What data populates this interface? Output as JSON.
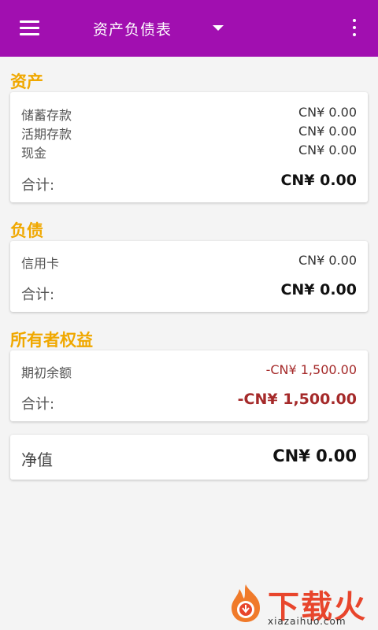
{
  "appbar": {
    "title": "资产负债表",
    "menu_icon": "hamburger-menu-icon",
    "dropdown_icon": "caret-down-icon",
    "more_icon": "more-vertical-icon",
    "color": "#a10fb0"
  },
  "sections": {
    "assets": {
      "title": "资产",
      "items": [
        {
          "label": "储蓄存款",
          "value": "CN¥ 0.00"
        },
        {
          "label": "活期存款",
          "value": "CN¥ 0.00"
        },
        {
          "label": "现金",
          "value": "CN¥ 0.00"
        }
      ],
      "total_label": "合计:",
      "total_value": "CN¥ 0.00"
    },
    "liabilities": {
      "title": "负债",
      "items": [
        {
          "label": "信用卡",
          "value": "CN¥ 0.00"
        }
      ],
      "total_label": "合计:",
      "total_value": "CN¥ 0.00"
    },
    "equity": {
      "title": "所有者权益",
      "items": [
        {
          "label": "期初余额",
          "value": "-CN¥ 1,500.00"
        }
      ],
      "total_label": "合计:",
      "total_value": "-CN¥ 1,500.00"
    }
  },
  "net": {
    "label": "净值",
    "value": "CN¥ 0.00"
  },
  "colors": {
    "section_title": "#f0a800",
    "negative": "#a52a2a"
  },
  "watermark": {
    "text": "下载火",
    "url": "xiazaihuo.com",
    "icon": "flame-logo-icon"
  }
}
